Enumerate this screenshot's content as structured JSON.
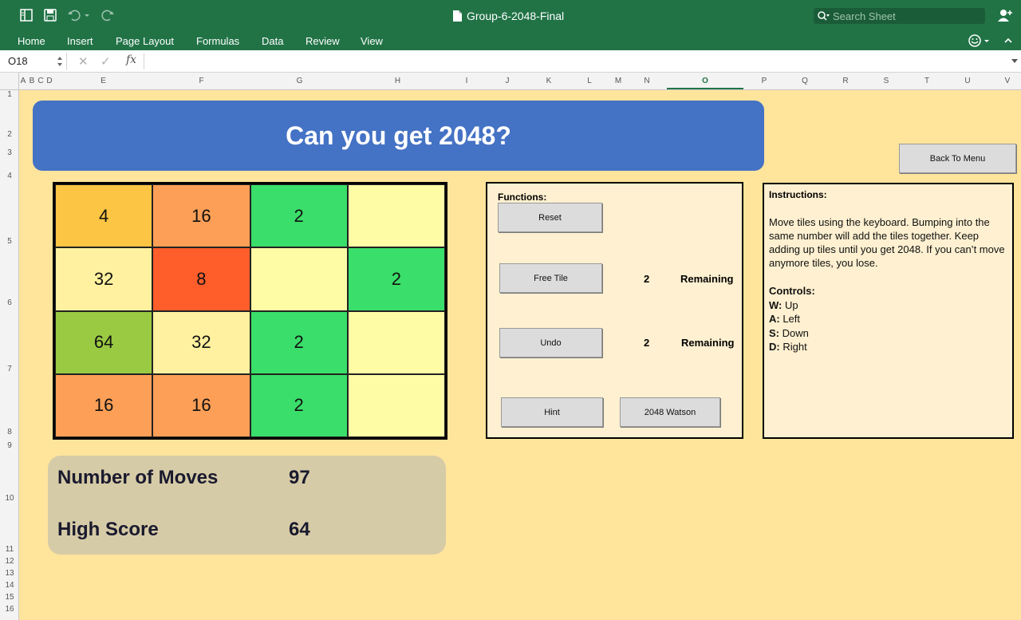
{
  "app": {
    "doc_title": "Group-6-2048-Final",
    "search_placeholder": "Search Sheet"
  },
  "ribbon_tabs": [
    "Home",
    "Insert",
    "Page Layout",
    "Formulas",
    "Data",
    "Review",
    "View"
  ],
  "formula_bar": {
    "name_box": "O18",
    "formula": ""
  },
  "columns": [
    "A",
    "B",
    "C",
    "D",
    "E",
    "F",
    "G",
    "H",
    "I",
    "J",
    "K",
    "L",
    "M",
    "N",
    "O",
    "P",
    "Q",
    "R",
    "S",
    "T",
    "U",
    "V"
  ],
  "rows": [
    "1",
    "2",
    "3",
    "4",
    "5",
    "6",
    "7",
    "8",
    "9",
    "10",
    "11",
    "12",
    "13",
    "14",
    "15",
    "16"
  ],
  "selected_column": "O",
  "banner": {
    "title": "Can you get 2048?"
  },
  "back_button": "Back To Menu",
  "board": [
    [
      {
        "v": "4",
        "color": "#fcc543"
      },
      {
        "v": "16",
        "color": "#fd9f56"
      },
      {
        "v": "2",
        "color": "#3ade6a"
      },
      {
        "v": "",
        "color": "#fffca6"
      }
    ],
    [
      {
        "v": "32",
        "color": "#fff19f"
      },
      {
        "v": "8",
        "color": "#ff5e2b"
      },
      {
        "v": "",
        "color": "#fffca6"
      },
      {
        "v": "2",
        "color": "#3ade6a"
      }
    ],
    [
      {
        "v": "64",
        "color": "#9aca42"
      },
      {
        "v": "32",
        "color": "#fff19f"
      },
      {
        "v": "2",
        "color": "#3ade6a"
      },
      {
        "v": "",
        "color": "#fffca6"
      }
    ],
    [
      {
        "v": "16",
        "color": "#fd9f56"
      },
      {
        "v": "16",
        "color": "#fd9f56"
      },
      {
        "v": "2",
        "color": "#3ade6a"
      },
      {
        "v": "",
        "color": "#fffca6"
      }
    ]
  ],
  "functions": {
    "title": "Functions:",
    "reset": "Reset",
    "free_tile": "Free Tile",
    "free_tile_count": "2",
    "free_tile_remaining": "Remaining",
    "undo": "Undo",
    "undo_count": "2",
    "undo_remaining": "Remaining",
    "hint": "Hint",
    "watson": "2048 Watson"
  },
  "instructions": {
    "title": "Instructions:",
    "text": "Move tiles using the keyboard. Bumping into the same number will add the tiles together. Keep adding up tiles until you get 2048. If you can’t move anymore tiles, you lose.",
    "controls_title": "Controls:",
    "controls": [
      {
        "key": "W:",
        "action": " Up"
      },
      {
        "key": "A:",
        "action": " Left"
      },
      {
        "key": "S:",
        "action": " Down"
      },
      {
        "key": "D:",
        "action": " Right"
      }
    ]
  },
  "score": {
    "moves_label": "Number of Moves",
    "moves_value": "97",
    "high_label": "High Score",
    "high_value": "64"
  }
}
